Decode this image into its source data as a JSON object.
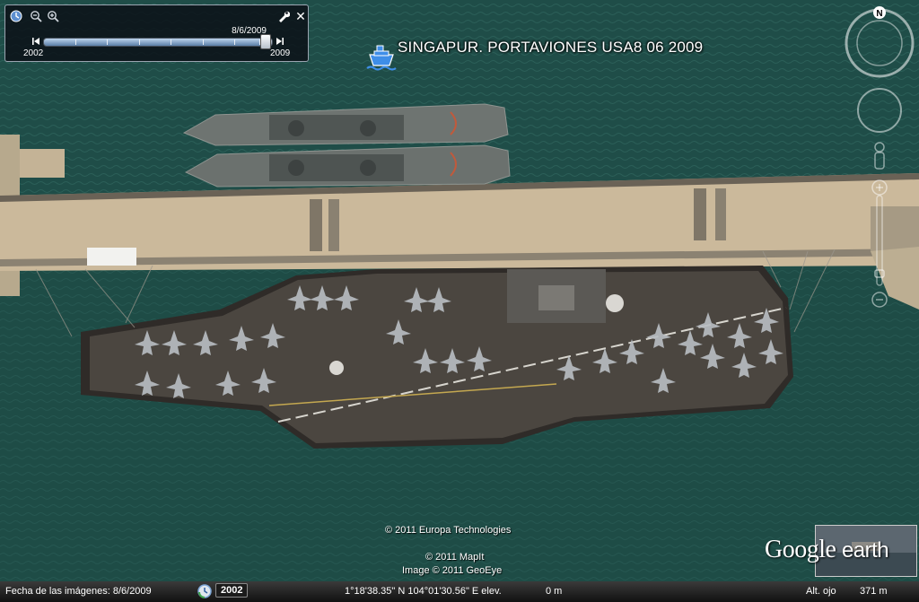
{
  "time_slider": {
    "current_date": "8/6/2009",
    "start_year": "2002",
    "end_year": "2009",
    "position": 0.97,
    "icons": [
      "clock-icon",
      "zoom-out-icon",
      "zoom-in-icon",
      "wrench-icon",
      "close-icon",
      "skip-back-icon",
      "skip-forward-icon"
    ]
  },
  "placemark": {
    "label": "SINGAPUR. PORTAVIONES USA8 06 2009",
    "icon": "ship-icon"
  },
  "navigation": {
    "north_label": "N",
    "icons": [
      "look-ring",
      "move-ring",
      "street-view-pegman-icon",
      "zoom-slider"
    ]
  },
  "credits": {
    "europa": "© 2011 Europa Technologies",
    "mapit": "© 2011 MapIt",
    "geoeye": "Image © 2011 GeoEye"
  },
  "logo": {
    "word1": "Google",
    "word2": "earth"
  },
  "status_bar": {
    "imagery_date": "Fecha de las imágenes: 8/6/2009",
    "history_year": "2002",
    "coordinates": "1°18'38.35\" N 104°01'30.56\" E elev.",
    "elevation": "0 m",
    "eye_label": "Alt. ojo",
    "eye_altitude": "371 m"
  },
  "colors": {
    "water": "#1f4d48",
    "pier": "#c9b89a",
    "deck": "#4b4640",
    "accent": "#5b7fa8"
  }
}
